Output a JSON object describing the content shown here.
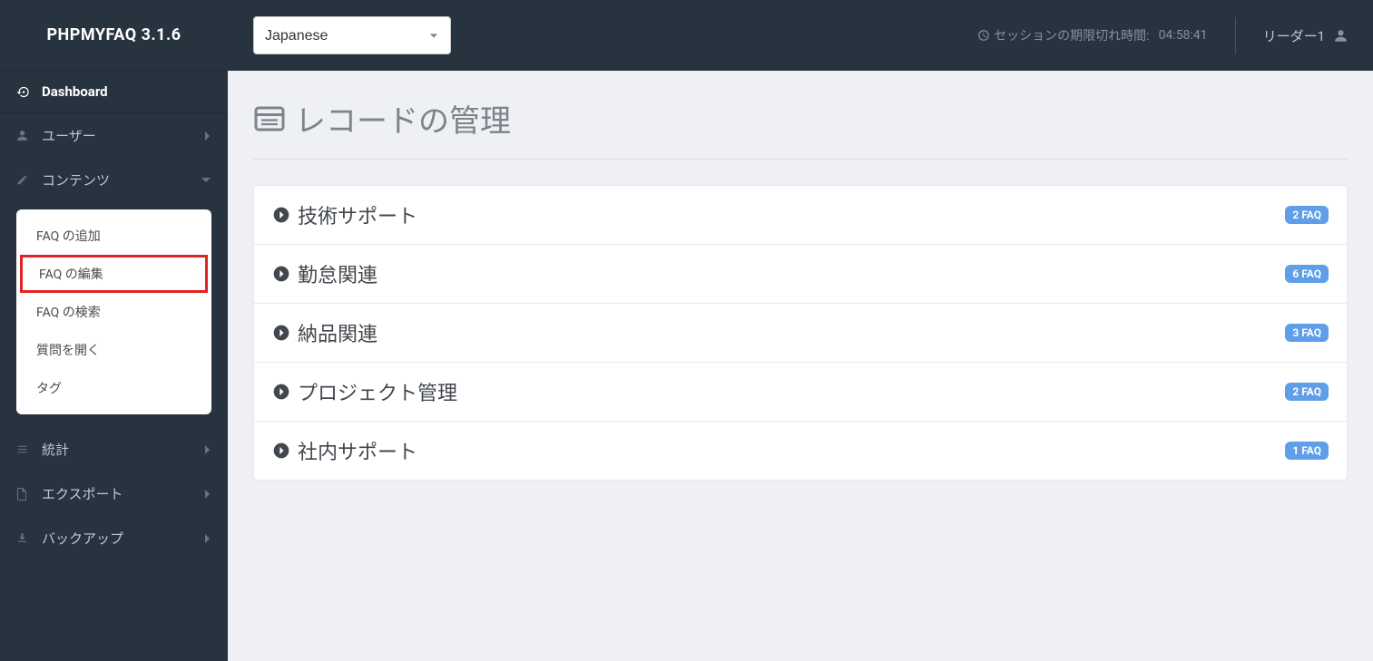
{
  "app": {
    "title": "PHPMYFAQ 3.1.6"
  },
  "topbar": {
    "language": "Japanese",
    "session_label": "セッションの期限切れ時間:",
    "session_time": "04:58:41",
    "user_name": "リーダー1"
  },
  "sidebar": {
    "dashboard": "Dashboard",
    "users": "ユーザー",
    "contents": "コンテンツ",
    "stats": "統計",
    "export": "エクスポート",
    "backup": "バックアップ",
    "submenu": {
      "add_faq": "FAQ の追加",
      "edit_faq": "FAQ の編集",
      "search_faq": "FAQ の検索",
      "open_question": "質問を開く",
      "tag": "タグ"
    }
  },
  "page": {
    "title": "レコードの管理"
  },
  "records": [
    {
      "label": "技術サポート",
      "badge": "2 FAQ"
    },
    {
      "label": "勤怠関連",
      "badge": "6 FAQ"
    },
    {
      "label": "納品関連",
      "badge": "3 FAQ"
    },
    {
      "label": "プロジェクト管理",
      "badge": "2 FAQ"
    },
    {
      "label": "社内サポート",
      "badge": "1 FAQ"
    }
  ]
}
